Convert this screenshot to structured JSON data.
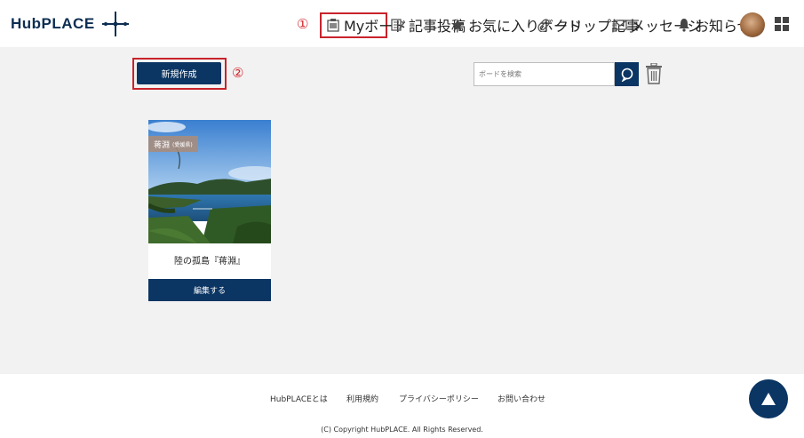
{
  "header": {
    "logo_text": "HubPLACE",
    "annotation_1": "①",
    "nav": [
      {
        "label": "Myボード",
        "icon": "clipboard-icon"
      },
      {
        "label": "記事投稿",
        "icon": "edit-icon"
      },
      {
        "label": "お気に入りボード",
        "icon": "star-icon"
      },
      {
        "label": "クリップ記事",
        "icon": "paperclip-icon"
      },
      {
        "label": "メッセージ",
        "icon": "mail-icon"
      },
      {
        "label": "お知らせ",
        "icon": "bell-icon"
      }
    ]
  },
  "toolbar": {
    "new_label": "新規作成",
    "annotation_2": "②",
    "search_placeholder": "ボードを検索"
  },
  "card": {
    "tag_main": "蒋淵",
    "tag_sub": "(愛媛県)",
    "title": "陸の孤島『蒋淵』",
    "edit_label": "編集する"
  },
  "footer": {
    "links": [
      "HubPLACEとは",
      "利用規約",
      "プライバシーポリシー",
      "お問い合わせ"
    ],
    "copyright": "(C) Copyright HubPLACE. All Rights Reserved."
  },
  "colors": {
    "brand_navy": "#0b3563",
    "annotation_red": "#c8232c",
    "background": "#f2f2f2"
  }
}
